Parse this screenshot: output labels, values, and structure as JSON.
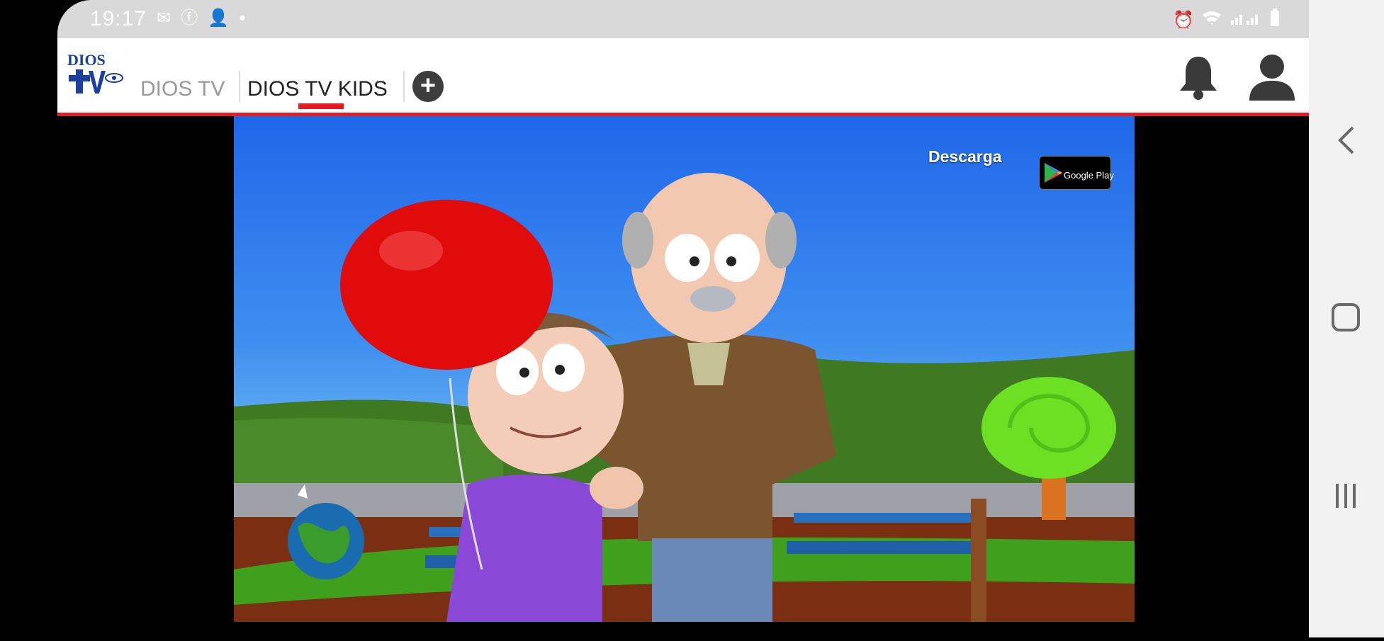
{
  "status_bar": {
    "time": "19:17"
  },
  "header": {
    "logo_text": "DIOS",
    "tabs": [
      {
        "label": "DIOS TV",
        "active": false
      },
      {
        "label": "DIOS TV KIDS",
        "active": true
      }
    ],
    "accent_color": "#e51b23"
  },
  "video": {
    "overlay_text": "Descarga",
    "store_badge": "Google Play"
  },
  "icons": {
    "add": "plus-icon",
    "notifications": "bell-icon",
    "profile": "user-icon",
    "back": "chevron-left-icon",
    "home": "home-icon",
    "recents": "recents-icon"
  }
}
